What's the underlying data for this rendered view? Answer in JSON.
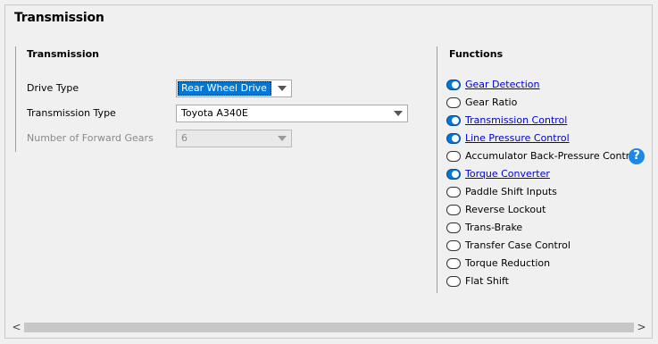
{
  "panel": {
    "title": "Transmission"
  },
  "transmission_section": {
    "title": "Transmission",
    "fields": {
      "drive_type": {
        "label": "Drive Type",
        "value": "Rear Wheel Drive"
      },
      "transmission_type": {
        "label": "Transmission Type",
        "value": "Toyota A340E"
      },
      "forward_gears": {
        "label": "Number of Forward Gears",
        "value": "6"
      }
    }
  },
  "functions_section": {
    "title": "Functions",
    "items": [
      {
        "label": "Gear Detection",
        "enabled": true,
        "link": true
      },
      {
        "label": "Gear Ratio",
        "enabled": false,
        "link": false
      },
      {
        "label": "Transmission Control",
        "enabled": true,
        "link": true
      },
      {
        "label": "Line Pressure Control",
        "enabled": true,
        "link": true
      },
      {
        "label": "Accumulator Back-Pressure Control",
        "enabled": false,
        "link": false
      },
      {
        "label": "Torque Converter",
        "enabled": true,
        "link": true
      },
      {
        "label": "Paddle Shift Inputs",
        "enabled": false,
        "link": false
      },
      {
        "label": "Reverse Lockout",
        "enabled": false,
        "link": false
      },
      {
        "label": "Trans-Brake",
        "enabled": false,
        "link": false
      },
      {
        "label": "Transfer Case Control",
        "enabled": false,
        "link": false
      },
      {
        "label": "Torque Reduction",
        "enabled": false,
        "link": false
      },
      {
        "label": "Flat Shift",
        "enabled": false,
        "link": false
      }
    ],
    "help_icon": "question-mark-icon"
  },
  "scrollbar": {
    "left_arrow": "<",
    "right_arrow": ">"
  },
  "colors": {
    "accent": "#0078d7",
    "link": "#0000cc",
    "help": "#1e88e5"
  }
}
